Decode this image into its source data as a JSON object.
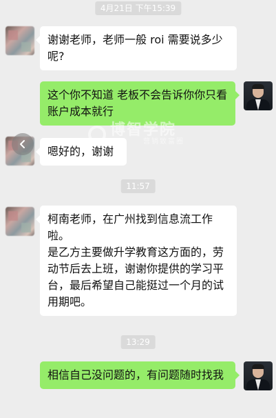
{
  "timestamps": {
    "t1": "4月21日 下午15:39",
    "t2": "11:57",
    "t3": "13:29"
  },
  "messages": [
    {
      "side": "in",
      "text": "谢谢老师，老师一般 roi 需要说多少呢?"
    },
    {
      "side": "out",
      "text": "这个你不知道    老板不会告诉你你只看账户成本就行"
    },
    {
      "side": "in",
      "text": "嗯好的，谢谢"
    },
    {
      "side": "in",
      "text": "柯南老师，在广州找到信息流工作啦。\n是乙方主要做升学教育这方面的，劳动节后去上班，谢谢你提供的学习平台，最后希望自己能挺过一个月的试用期吧。"
    },
    {
      "side": "out",
      "text": "相信自己没问题的，有问题随时找我"
    }
  ],
  "watermark": {
    "main": "博智学院",
    "sub": "营销致富圈"
  },
  "icons": {
    "back": "chevron-left-icon",
    "sender_avatar": "avatar-blurred",
    "teacher_avatar": "avatar-teacher"
  },
  "colors": {
    "background": "#ededed",
    "incoming_bubble": "#ffffff",
    "outgoing_bubble": "#95ec69",
    "timestamp_bg": "#dadada"
  }
}
